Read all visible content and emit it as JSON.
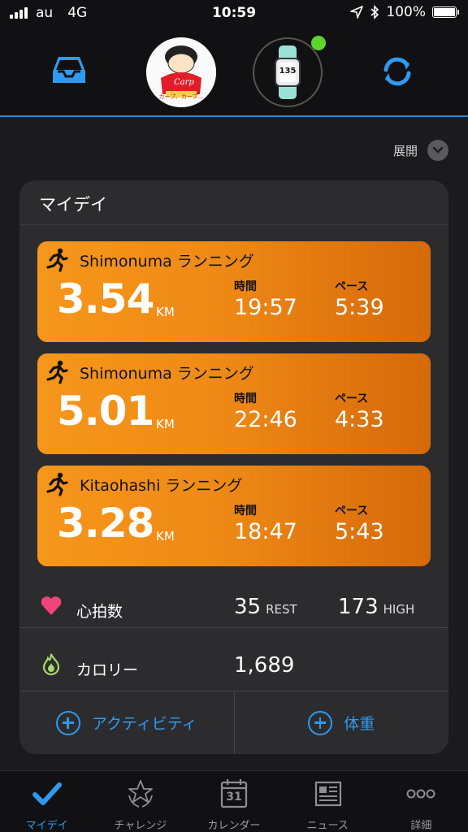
{
  "status_bar": {
    "carrier": "au",
    "network": "4G",
    "time": "10:59",
    "battery": "100%"
  },
  "header": {
    "inbox_icon": "inbox-icon",
    "avatar_caption": "カープ、カープ…",
    "device_number": "135",
    "sync_icon": "sync-icon"
  },
  "expand_label": "展開",
  "my_day": {
    "title": "マイデイ",
    "activities": [
      {
        "name": "Shimonuma ランニング",
        "distance": "3.54",
        "unit": "KM",
        "time_label": "時間",
        "time": "19:57",
        "pace_label": "ペース",
        "pace": "5:39"
      },
      {
        "name": "Shimonuma ランニング",
        "distance": "5.01",
        "unit": "KM",
        "time_label": "時間",
        "time": "22:46",
        "pace_label": "ペース",
        "pace": "4:33"
      },
      {
        "name": "Kitaohashi ランニング",
        "distance": "3.28",
        "unit": "KM",
        "time_label": "時間",
        "time": "18:47",
        "pace_label": "ペース",
        "pace": "5:43"
      }
    ],
    "heart_rate": {
      "label": "心拍数",
      "rest": "35",
      "rest_unit": "REST",
      "high": "173",
      "high_unit": "HIGH"
    },
    "calories": {
      "label": "カロリー",
      "value": "1,689"
    },
    "actions": {
      "activity": "アクティビティ",
      "weight": "体重"
    }
  },
  "tabs": [
    {
      "label": "マイデイ",
      "icon": "checkmark-icon",
      "active": true
    },
    {
      "label": "チャレンジ",
      "icon": "laurel-icon",
      "active": false
    },
    {
      "label": "カレンダー",
      "icon": "calendar-icon",
      "active": false,
      "day": "31"
    },
    {
      "label": "ニュース",
      "icon": "newspaper-icon",
      "active": false
    },
    {
      "label": "詳細",
      "icon": "more-icon",
      "active": false
    }
  ],
  "colors": {
    "accent": "#2f9af0",
    "activity_orange": "#f6961b",
    "heart": "#f0457a",
    "calorie": "#a6d86a"
  }
}
